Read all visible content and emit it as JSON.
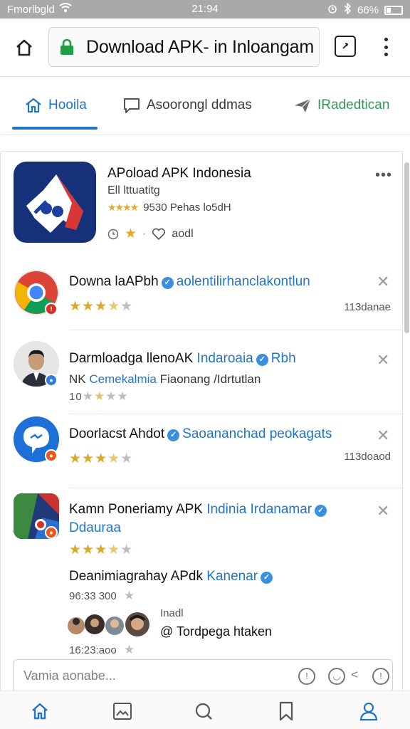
{
  "status_bar": {
    "carrier": "Fmorlbgld",
    "time": "21:94",
    "battery": "66%"
  },
  "url_bar": {
    "url_text": "Download APK- in Inloangam"
  },
  "tabs": [
    {
      "label": "Hooila",
      "icon": "home-outline-icon",
      "active": true
    },
    {
      "label": "Asoorongl ddmas",
      "icon": "chat-bubble-icon",
      "active": false
    },
    {
      "label": "IRadedtican",
      "icon": "send-arrow-icon",
      "active": false
    }
  ],
  "featured": {
    "title": "APoload APK Indonesia",
    "subtitle": "Ell lttuatitg",
    "stars": "★★★★",
    "rating_text": "9530 Pehas lo5dH",
    "actions": "aodl",
    "more": "•••"
  },
  "rows": [
    {
      "title": "Downa laAPbh",
      "blue_text": "aolentilirhanclakontlun",
      "stars_on": "★★★",
      "stars_half": "★",
      "stars_off": "★",
      "time": "113danae"
    },
    {
      "title": "Darmloadga llenoAK",
      "blue_text": "Indaroaia",
      "after_text": "Rbh",
      "line2_prefix": "NK",
      "line2_blue": "Cemekalmia",
      "line2_rest": "Fiaonang /Idrtutlan",
      "line3": "10"
    },
    {
      "title": "Doorlacst Ahdot",
      "blue_text": "Saoananchad peokagats",
      "time": "113doaod"
    },
    {
      "title": "Kamn Poneriamy APK",
      "blue_text": "Indinia Irdanamar",
      "line2": "Ddauraa",
      "sub_title": "Deanimiagrahay APdk",
      "sub_blue": "Kanenar",
      "sub_time": "96:33 300",
      "sub_label": "Inadl",
      "mention": "@ Tordpega htaken",
      "bottom_time": "16:23:aoo"
    }
  ],
  "comment": {
    "placeholder": "Vamia aonabe..."
  },
  "colors": {
    "accent_blue": "#1f75c8",
    "accent_green": "#2e9a57",
    "star": "#d9a830",
    "app_icon_bg": "#17307a"
  }
}
